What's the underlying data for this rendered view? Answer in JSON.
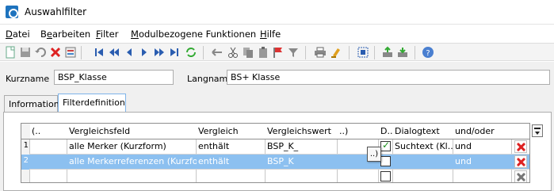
{
  "window": {
    "title": "Auswahlfilter"
  },
  "menu": {
    "items": [
      {
        "pre": "",
        "u": "D",
        "post": "atei"
      },
      {
        "pre": "B",
        "u": "e",
        "post": "arbeiten"
      },
      {
        "pre": "",
        "u": "F",
        "post": "ilter"
      },
      {
        "pre": "",
        "u": "M",
        "post": "odulbezogene Funktionen"
      },
      {
        "pre": "",
        "u": "H",
        "post": "ilfe"
      }
    ]
  },
  "toolbar": {
    "icons": [
      "new-icon",
      "save-icon",
      "undo-icon",
      "delete-icon",
      "properties-icon",
      "first-record-icon",
      "prev-page-icon",
      "prev-record-icon",
      "next-record-icon",
      "next-page-icon",
      "last-record-icon",
      "refresh-icon",
      "back-icon",
      "cut-icon",
      "copy-icon",
      "paste-icon",
      "flag-icon",
      "filter-icon",
      "print-icon",
      "clear-icon",
      "select-all-icon",
      "export-icon",
      "import-icon",
      "help-icon"
    ]
  },
  "form": {
    "kurzname_label": "Kurzname",
    "kurzname_value": "BSP_Klasse",
    "langname_label": "Langname",
    "langname_value": "BS+ Klasse"
  },
  "tabs": [
    {
      "label": "Information",
      "active": false
    },
    {
      "label": "Filterdefinition",
      "active": true
    }
  ],
  "grid": {
    "headers": [
      "(..",
      "Vergleichsfeld",
      "Vergleich",
      "Vergleichswert",
      "..)",
      "D...",
      "Dialogtext",
      "und/oder"
    ],
    "rows": [
      {
        "num": "1",
        "open": "",
        "field": "alle Merker (Kurzform)",
        "op": "enthält",
        "value": "BSP_K_",
        "close": "",
        "dialog_checked": true,
        "dialogtext": "Suchtext (Kl...",
        "logic": "und",
        "selected": false
      },
      {
        "num": "2",
        "open": "",
        "field": "alle Merkerreferenzen (Kurzfo...",
        "op": "enthält",
        "value": "BSP_K",
        "close": "",
        "dialog_checked": false,
        "dialogtext": "",
        "logic": "und",
        "selected": true
      },
      {
        "num": "",
        "open": "",
        "field": "",
        "op": "",
        "value": "",
        "close": "",
        "dialog_checked": false,
        "dialogtext": "",
        "logic": "",
        "selected": false
      }
    ],
    "popup_label": "..)"
  },
  "colors": {
    "selection": "#8cc0f0",
    "accent": "#1e73be",
    "delete": "#dd2222"
  }
}
